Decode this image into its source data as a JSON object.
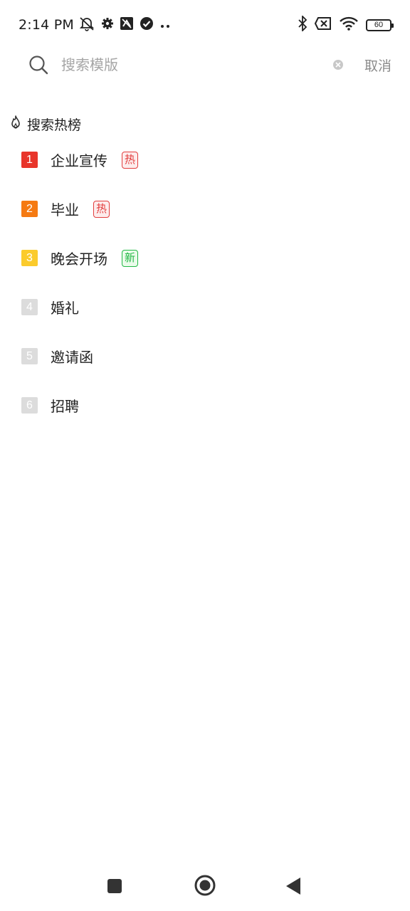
{
  "status_bar": {
    "time": "2:14 PM",
    "battery_level": "60",
    "icons": [
      "mute-icon",
      "settings-icon",
      "sync-icon",
      "check-circle-icon",
      "more-dots-icon",
      "bluetooth-icon",
      "no-sim-icon",
      "wifi-icon",
      "battery-icon"
    ]
  },
  "search": {
    "placeholder": "搜索模版",
    "value": "",
    "cancel_label": "取消"
  },
  "hot": {
    "title": "搜索热榜",
    "items": [
      {
        "rank": "1",
        "label": "企业宣传",
        "tag": "热",
        "rank_color": "#e8352b",
        "tag_type": "hot"
      },
      {
        "rank": "2",
        "label": "毕业",
        "tag": "热",
        "rank_color": "#f57a12",
        "tag_type": "hot"
      },
      {
        "rank": "3",
        "label": "晚会开场",
        "tag": "新",
        "rank_color": "#fbcb2c",
        "tag_type": "new"
      },
      {
        "rank": "4",
        "label": "婚礼",
        "tag": "",
        "rank_color": "#dcdcdc",
        "tag_type": ""
      },
      {
        "rank": "5",
        "label": "邀请函",
        "tag": "",
        "rank_color": "#dcdcdc",
        "tag_type": ""
      },
      {
        "rank": "6",
        "label": "招聘",
        "tag": "",
        "rank_color": "#dcdcdc",
        "tag_type": ""
      }
    ]
  },
  "colors": {
    "hot_tag_text": "#e23d3d",
    "hot_tag_bg": "#fdecec",
    "new_tag_text": "#22b845",
    "new_tag_bg": "#eafbea"
  }
}
